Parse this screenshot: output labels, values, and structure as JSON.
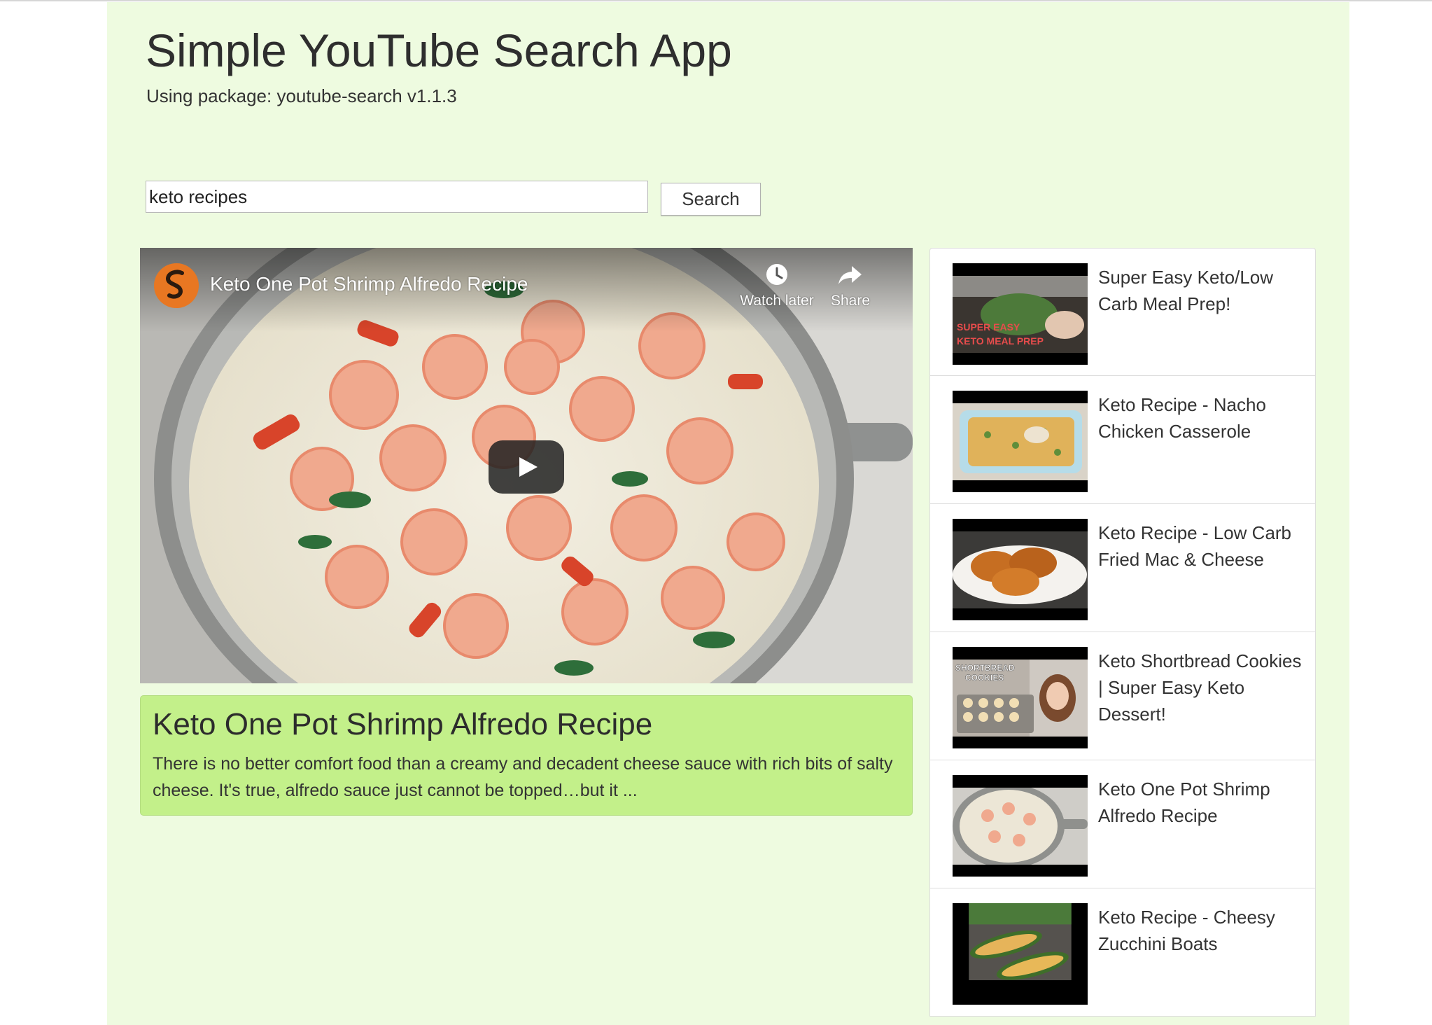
{
  "app": {
    "title": "Simple YouTube Search App",
    "subtitle": "Using package: youtube-search v1.1.3",
    "background": "#eefbe0"
  },
  "search": {
    "value": "keto recipes",
    "button_label": "Search"
  },
  "player": {
    "title": "Keto One Pot Shrimp Alfredo Recipe",
    "watch_later_label": "Watch later",
    "share_label": "Share",
    "channel_logo_icon": "channel-logo-icon",
    "play_icon": "play-icon"
  },
  "selected_video": {
    "title": "Keto One Pot Shrimp Alfredo Recipe",
    "description": "There is no better comfort food than a creamy and decadent cheese sauce with rich bits of salty cheese. It's true, alfredo sauce just cannot be topped…but it ...",
    "card_color": "#c3f08a"
  },
  "video_list": [
    {
      "title": "Super Easy Keto/Low Carb Meal Prep!",
      "thumb_overlay": "SUPER EASY KETO MEAL PREP"
    },
    {
      "title": "Keto Recipe - Nacho Chicken Casserole"
    },
    {
      "title": "Keto Recipe - Low Carb Fried Mac & Cheese"
    },
    {
      "title": "Keto Shortbread Cookies | Super Easy Keto Dessert!",
      "thumb_overlay": "SHORTBREAD COOKIES"
    },
    {
      "title": "Keto One Pot Shrimp Alfredo Recipe"
    },
    {
      "title": "Keto Recipe - Cheesy Zucchini Boats"
    }
  ]
}
